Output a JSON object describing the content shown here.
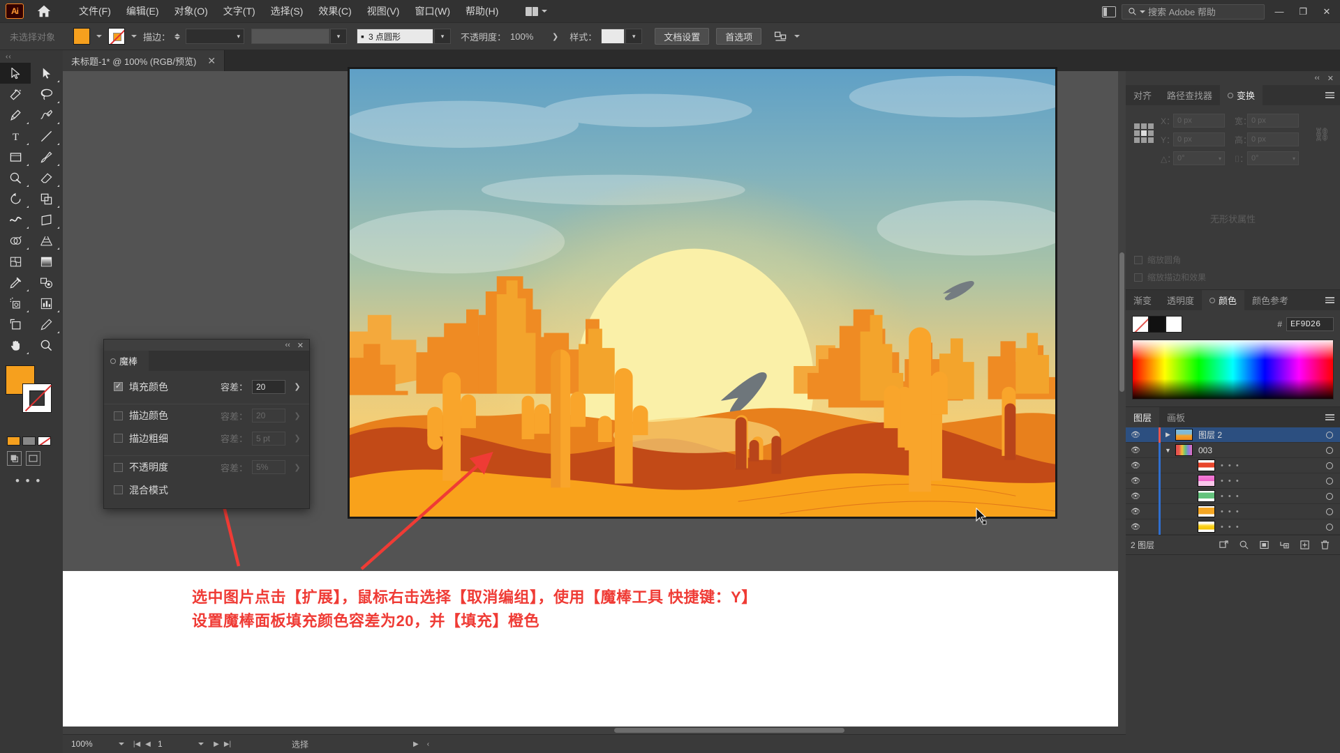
{
  "app": {
    "logo_text": "Ai",
    "home_icon": "home-icon"
  },
  "menubar": {
    "items": [
      {
        "label": "文件(F)"
      },
      {
        "label": "编辑(E)"
      },
      {
        "label": "对象(O)"
      },
      {
        "label": "文字(T)"
      },
      {
        "label": "选择(S)"
      },
      {
        "label": "效果(C)"
      },
      {
        "label": "视图(V)"
      },
      {
        "label": "窗口(W)"
      },
      {
        "label": "帮助(H)"
      }
    ],
    "arrange_label": "",
    "search_placeholder": "搜索 Adobe 帮助",
    "window_minimize": "—",
    "window_restore": "❐",
    "window_close": "✕"
  },
  "optionsbar": {
    "selection_status": "未选择对象",
    "fill_color": "#F6A01E",
    "stroke_label": "描边：",
    "stroke_weight": "",
    "stroke_profile": "",
    "brush_label": "3 点圆形",
    "opacity_label": "不透明度：",
    "opacity_value": "100%",
    "style_label": "样式：",
    "document_setup_label": "文档设置",
    "preferences_label": "首选项"
  },
  "document_tab": {
    "title": "未标题-1* @ 100% (RGB/预览)",
    "close": "✕"
  },
  "toolbar": {
    "collapse": "‹‹",
    "tools": [
      {
        "name": "selection-tool",
        "active": true
      },
      {
        "name": "direct-selection-tool",
        "active": false
      },
      {
        "name": "magic-wand-tool",
        "active": false
      },
      {
        "name": "lasso-tool",
        "active": false
      },
      {
        "name": "pen-tool",
        "active": false
      },
      {
        "name": "curvature-tool",
        "active": false
      },
      {
        "name": "type-tool",
        "active": false
      },
      {
        "name": "line-segment-tool",
        "active": false
      },
      {
        "name": "rectangle-tool",
        "active": false
      },
      {
        "name": "paintbrush-tool",
        "active": false
      },
      {
        "name": "shaper-tool",
        "active": false
      },
      {
        "name": "eraser-tool",
        "active": false
      },
      {
        "name": "rotate-tool",
        "active": false
      },
      {
        "name": "scale-tool",
        "active": false
      },
      {
        "name": "width-tool",
        "active": false
      },
      {
        "name": "free-transform-tool",
        "active": false
      },
      {
        "name": "shape-builder-tool",
        "active": false
      },
      {
        "name": "perspective-grid-tool",
        "active": false
      },
      {
        "name": "mesh-tool",
        "active": false
      },
      {
        "name": "gradient-tool",
        "active": false
      },
      {
        "name": "eyedropper-tool",
        "active": false
      },
      {
        "name": "blend-tool",
        "active": false
      },
      {
        "name": "symbol-sprayer-tool",
        "active": false
      },
      {
        "name": "column-graph-tool",
        "active": false
      },
      {
        "name": "artboard-tool",
        "active": false
      },
      {
        "name": "slice-tool",
        "active": false
      },
      {
        "name": "hand-tool",
        "active": false
      },
      {
        "name": "zoom-tool",
        "active": false
      }
    ],
    "more_tools": "• • •"
  },
  "magic_wand_panel": {
    "title": "魔棒",
    "close": "✕",
    "collapse": "‹‹",
    "rows": [
      {
        "label": "填充颜色",
        "checked": true,
        "enabled": true,
        "tolerance_label": "容差：",
        "tolerance_value": "20"
      },
      {
        "label": "描边颜色",
        "checked": false,
        "enabled": false,
        "tolerance_label": "容差：",
        "tolerance_value": "20"
      },
      {
        "label": "描边粗细",
        "checked": false,
        "enabled": false,
        "tolerance_label": "容差：",
        "tolerance_value": "5 pt"
      },
      {
        "label": "不透明度",
        "checked": false,
        "enabled": false,
        "tolerance_label": "容差：",
        "tolerance_value": "5%"
      },
      {
        "label": "混合模式",
        "checked": false,
        "enabled": false,
        "tolerance_label": "",
        "tolerance_value": ""
      }
    ]
  },
  "transform_panel": {
    "tabs": [
      {
        "label": "对齐",
        "active": false
      },
      {
        "label": "路径查找器",
        "active": false
      },
      {
        "label": "变换",
        "active": true
      }
    ],
    "fields": {
      "x_label": "X：",
      "x_value": "0 px",
      "y_label": "Y：",
      "y_value": "0 px",
      "w_label": "宽：",
      "w_value": "0 px",
      "h_label": "高：",
      "h_value": "0 px",
      "angle_label": "△：",
      "angle_value": "0°",
      "shear_label": "⌷：",
      "shear_value": "0°"
    },
    "shape_props_empty": "无形状属性",
    "options": [
      {
        "label": "缩放圆角"
      },
      {
        "label": "缩放描边和效果"
      }
    ]
  },
  "color_panel": {
    "tabs": [
      {
        "label": "渐变",
        "active": false
      },
      {
        "label": "透明度",
        "active": false
      },
      {
        "label": "颜色",
        "active": true
      },
      {
        "label": "颜色参考",
        "active": false
      }
    ],
    "hash": "#",
    "hex_value": "EF9D26"
  },
  "layers_panel": {
    "tabs": [
      {
        "label": "图层",
        "active": true
      },
      {
        "label": "画板",
        "active": false
      }
    ],
    "rows": [
      {
        "name": "图层 2",
        "selected": true,
        "indent": 0,
        "expanded": false,
        "has_twisty": true,
        "thumb": "landscape",
        "color": "#e8554e",
        "dots": ""
      },
      {
        "name": "003",
        "selected": false,
        "indent": 1,
        "expanded": true,
        "has_twisty": true,
        "thumb": "multicolor",
        "color": "#2f6fd0",
        "dots": ""
      },
      {
        "name": "",
        "selected": false,
        "indent": 2,
        "expanded": false,
        "has_twisty": false,
        "thumb": "red",
        "color": "#2f6fd0",
        "dots": "• • •"
      },
      {
        "name": "",
        "selected": false,
        "indent": 2,
        "expanded": false,
        "has_twisty": false,
        "thumb": "pink",
        "color": "#2f6fd0",
        "dots": "• • •"
      },
      {
        "name": "",
        "selected": false,
        "indent": 2,
        "expanded": false,
        "has_twisty": false,
        "thumb": "green",
        "color": "#2f6fd0",
        "dots": "• • •"
      },
      {
        "name": "",
        "selected": false,
        "indent": 2,
        "expanded": false,
        "has_twisty": false,
        "thumb": "orange",
        "color": "#2f6fd0",
        "dots": "• • •"
      },
      {
        "name": "",
        "selected": false,
        "indent": 2,
        "expanded": false,
        "has_twisty": false,
        "thumb": "yellow",
        "color": "#2f6fd0",
        "dots": "• • •"
      }
    ],
    "footer_count": "2 图层",
    "footer_icons": [
      "locate-object-icon",
      "search-icon",
      "make-clipping-mask-icon",
      "create-sublayer-icon",
      "create-new-layer-icon",
      "delete-selection-icon"
    ]
  },
  "statusbar": {
    "zoom_value": "100%",
    "page_value": "1",
    "status_text": "选择"
  },
  "annotation": {
    "line1": "选中图片点击【扩展】，鼠标右击选择【取消编组】，使用【魔棒工具 快捷键：Y】",
    "line2": "设置魔棒面板填充颜色容差为20，并【填充】橙色",
    "color": "#EF3B35"
  },
  "artwork": {
    "name": "desert-sunset-illustration",
    "sky_top": "#6FA8C8",
    "sky_mid": "#9FC2A8",
    "sun_color": "#FAF0A8",
    "sand_color": "#F9A21B",
    "mesa_color": "#F0871E",
    "dune_dark": "#C44A16",
    "cactus_color": "#F9A826",
    "bird_color": "#6B7378"
  }
}
